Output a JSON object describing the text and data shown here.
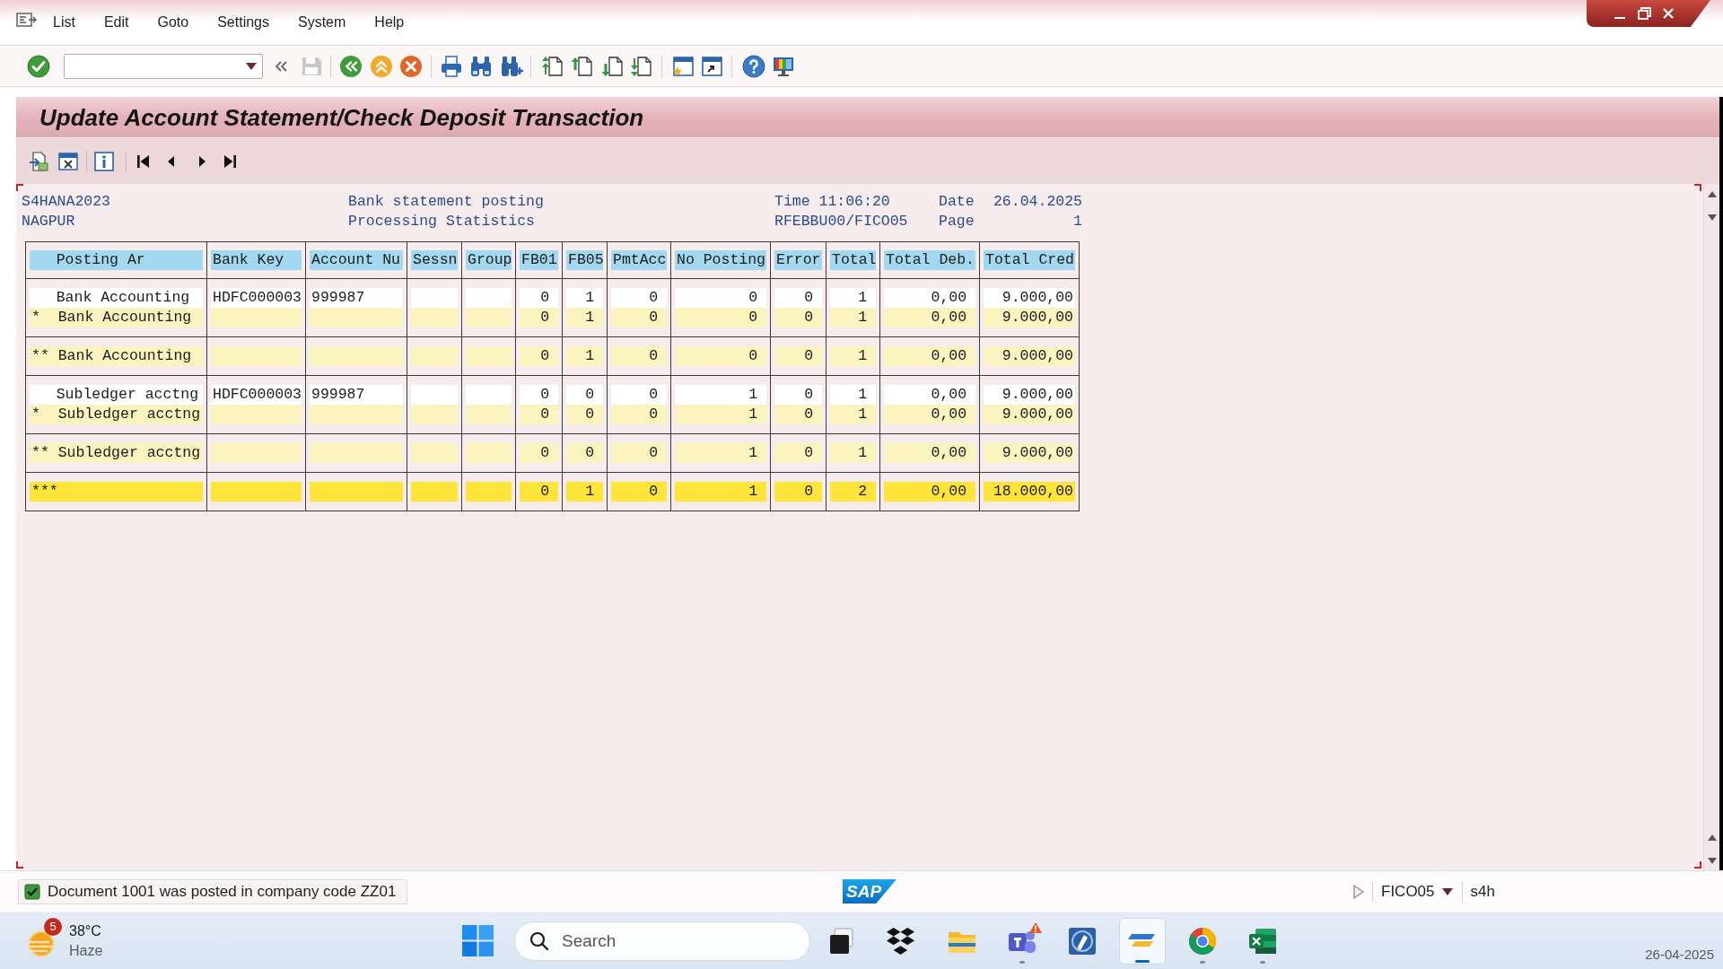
{
  "menu_bar": {
    "items": [
      "List",
      "Edit",
      "Goto",
      "Settings",
      "System",
      "Help"
    ]
  },
  "toolbar": {
    "save": {
      "disabled": true
    }
  },
  "title": "Update Account Statement/Check Deposit Transaction",
  "list_header": {
    "system": "S4HANA2023",
    "heading": "Bank statement posting",
    "time_label": "Time",
    "time": "11:06:20",
    "date_label": "Date",
    "date": "26.04.2025",
    "location": "NAGPUR",
    "subheading": "Processing Statistics",
    "program": "RFEBBU00/FICO05",
    "page_label": "Page",
    "page": "1"
  },
  "table": {
    "columns": {
      "posting_area": "Posting Ar",
      "bank_key": "Bank Key",
      "account_number": "Account Nu",
      "session": "Sessn",
      "group": "Group",
      "fb01": "FB01",
      "fb05": "FB05",
      "pmtacc": "PmtAcc",
      "no_posting": "No Posting",
      "error": "Error",
      "total": "Total",
      "total_debit": "Total Deb.",
      "total_credit": "Total Cred"
    },
    "groups": [
      {
        "rows": [
          {
            "kind": "item",
            "posting_area": "Bank Accounting",
            "bank_key": "HDFC000003",
            "account_number": "999987",
            "fb01": "0",
            "fb05": "1",
            "pmtacc": "0",
            "no_posting": "0",
            "error": "0",
            "total": "1",
            "total_debit": "0,00",
            "total_credit": "9.000,00"
          },
          {
            "kind": "subtotal",
            "posting_area": "*  Bank Accounting",
            "fb01": "0",
            "fb05": "1",
            "pmtacc": "0",
            "no_posting": "0",
            "error": "0",
            "total": "1",
            "total_debit": "0,00",
            "total_credit": "9.000,00"
          }
        ]
      },
      {
        "rows": [
          {
            "kind": "total",
            "posting_area": "** Bank Accounting",
            "fb01": "0",
            "fb05": "1",
            "pmtacc": "0",
            "no_posting": "0",
            "error": "0",
            "total": "1",
            "total_debit": "0,00",
            "total_credit": "9.000,00"
          }
        ]
      },
      {
        "rows": [
          {
            "kind": "item",
            "posting_area": "Subledger acctng",
            "bank_key": "HDFC000003",
            "account_number": "999987",
            "fb01": "0",
            "fb05": "0",
            "pmtacc": "0",
            "no_posting": "1",
            "error": "0",
            "total": "1",
            "total_debit": "0,00",
            "total_credit": "9.000,00"
          },
          {
            "kind": "subtotal",
            "posting_area": "*  Subledger acctng",
            "fb01": "0",
            "fb05": "0",
            "pmtacc": "0",
            "no_posting": "1",
            "error": "0",
            "total": "1",
            "total_debit": "0,00",
            "total_credit": "9.000,00"
          }
        ]
      },
      {
        "rows": [
          {
            "kind": "total",
            "posting_area": "** Subledger acctng",
            "fb01": "0",
            "fb05": "0",
            "pmtacc": "0",
            "no_posting": "1",
            "error": "0",
            "total": "1",
            "total_debit": "0,00",
            "total_credit": "9.000,00"
          }
        ]
      },
      {
        "rows": [
          {
            "kind": "grand_total",
            "posting_area": "***",
            "fb01": "0",
            "fb05": "1",
            "pmtacc": "0",
            "no_posting": "1",
            "error": "0",
            "total": "2",
            "total_debit": "0,00",
            "total_credit": "18.000,00"
          }
        ]
      }
    ]
  },
  "status_bar": {
    "message": {
      "kind": "success",
      "text": "Document 1001 was posted in company code ZZ01"
    },
    "logo": "SAP",
    "transaction": "FICO05",
    "server": "s4h"
  },
  "taskbar": {
    "weather": {
      "badge": "5",
      "temperature": "38°C",
      "condition": "Haze"
    },
    "search": {
      "placeholder": "Search"
    },
    "apps": [
      {
        "kind": "task_view",
        "active": false,
        "running": false,
        "alert": false
      },
      {
        "kind": "box_pattern",
        "active": false,
        "running": false,
        "alert": false
      },
      {
        "kind": "folder",
        "active": false,
        "running": false,
        "alert": false
      },
      {
        "kind": "chat",
        "active": false,
        "running": true,
        "alert": true
      },
      {
        "kind": "pencil_tile",
        "active": false,
        "running": false,
        "alert": false
      },
      {
        "kind": "stripes",
        "active": true,
        "running": true,
        "alert": false
      },
      {
        "kind": "browser",
        "active": false,
        "running": true,
        "alert": false
      },
      {
        "kind": "spreadsheet",
        "active": false,
        "running": true,
        "alert": false
      }
    ],
    "date": "26-04-2025"
  }
}
